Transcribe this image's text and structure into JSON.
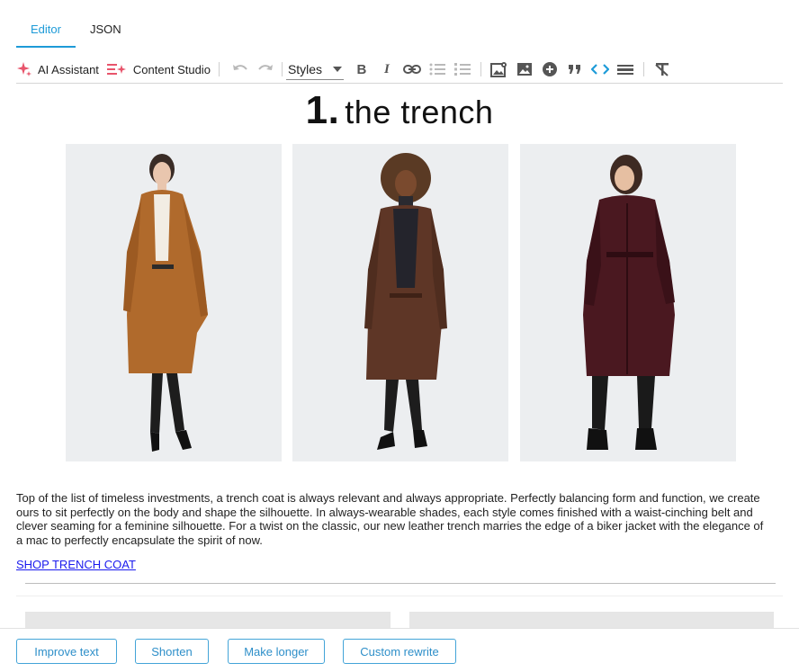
{
  "tabs": [
    {
      "label": "Editor",
      "active": true
    },
    {
      "label": "JSON",
      "active": false
    }
  ],
  "toolbar": {
    "ai_assistant_label": "AI Assistant",
    "content_studio_label": "Content Studio",
    "styles_label": "Styles",
    "icons": [
      "sparkle-icon",
      "content-studio-icon",
      "undo-icon",
      "redo-icon",
      "bold-icon",
      "italic-icon",
      "link-icon",
      "bulleted-list-icon",
      "numbered-list-icon",
      "image-manager-icon",
      "image-icon",
      "insert-plus-icon",
      "blockquote-icon",
      "source-code-icon",
      "horizontal-line-icon",
      "remove-format-icon"
    ],
    "accent_color": "#1e9bd8",
    "ai_color": "#e8546b"
  },
  "content": {
    "heading_number": "1.",
    "heading_text": "the trench",
    "images": [
      "camel-leather-trench",
      "brown-leather-trench",
      "burgundy-leather-trench"
    ],
    "paragraph": "Top of the list of timeless investments, a trench coat is always relevant and always appropriate. Perfectly balancing form and function, we create ours to sit perfectly on the body and shape the silhouette. In always-wearable shades, each style comes finished with a waist-cinching belt and clever seaming for a feminine silhouette. For a twist on the classic, our new leather trench marries the edge of a biker jacket with the elegance of a mac to perfectly encapsulate the spirit of now.",
    "shop_link": "SHOP TRENCH COAT"
  },
  "ai_actions": {
    "improve": "Improve text",
    "shorten": "Shorten",
    "longer": "Make longer",
    "custom": "Custom rewrite",
    "button_color": "#2e8fc9"
  }
}
